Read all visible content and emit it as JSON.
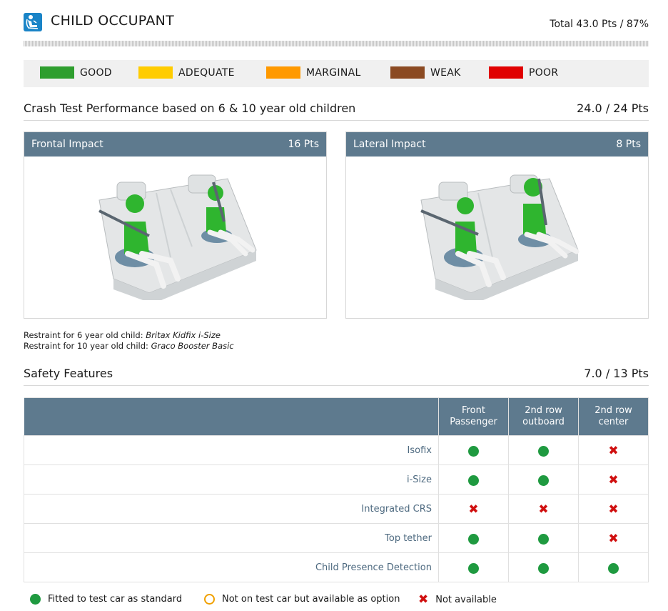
{
  "header": {
    "title": "CHILD OCCUPANT",
    "total": "Total 43.0 Pts / 87%",
    "icon": "child-seat-icon",
    "icon_color": "#1a84c7"
  },
  "legend": [
    {
      "label": "GOOD",
      "color": "#2e9e2e"
    },
    {
      "label": "ADEQUATE",
      "color": "#ffcc00"
    },
    {
      "label": "MARGINAL",
      "color": "#ff9900"
    },
    {
      "label": "WEAK",
      "color": "#8b4a22"
    },
    {
      "label": "POOR",
      "color": "#e00000"
    }
  ],
  "crash": {
    "title": "Crash Test Performance based on 6 & 10 year old children",
    "points": "24.0 / 24 Pts",
    "frontal": {
      "name": "Frontal Impact",
      "score": "16 Pts"
    },
    "lateral": {
      "name": "Lateral Impact",
      "score": "8 Pts"
    },
    "restraint6_label": "Restraint for 6 year old child:",
    "restraint6_value": "Britax Kidfix i-Size",
    "restraint10_label": "Restraint for 10 year old child:",
    "restraint10_value": "Graco Booster Basic"
  },
  "safety": {
    "title": "Safety Features",
    "points": "7.0 / 13 Pts",
    "columns": [
      {
        "line1": "Front",
        "line2": "Passenger"
      },
      {
        "line1": "2nd row",
        "line2": "outboard"
      },
      {
        "line1": "2nd row",
        "line2": "center"
      }
    ],
    "rows": [
      {
        "label": "Isofix",
        "marks": [
          "fitted",
          "fitted",
          "na"
        ]
      },
      {
        "label": "i-Size",
        "marks": [
          "fitted",
          "fitted",
          "na"
        ]
      },
      {
        "label": "Integrated CRS",
        "marks": [
          "na",
          "na",
          "na"
        ]
      },
      {
        "label": "Top tether",
        "marks": [
          "fitted",
          "fitted",
          "na"
        ]
      },
      {
        "label": "Child Presence Detection",
        "marks": [
          "fitted",
          "fitted",
          "fitted"
        ]
      }
    ]
  },
  "key": {
    "fitted": "Fitted to test car as standard",
    "option": "Not on test car but available as option",
    "na": "Not available"
  },
  "colors": {
    "header_blue": "#5e7a8e",
    "fitted_green": "#1f9a40",
    "na_red": "#d01010",
    "option_orange": "#f0a000",
    "dummy_green": "#22b022"
  }
}
